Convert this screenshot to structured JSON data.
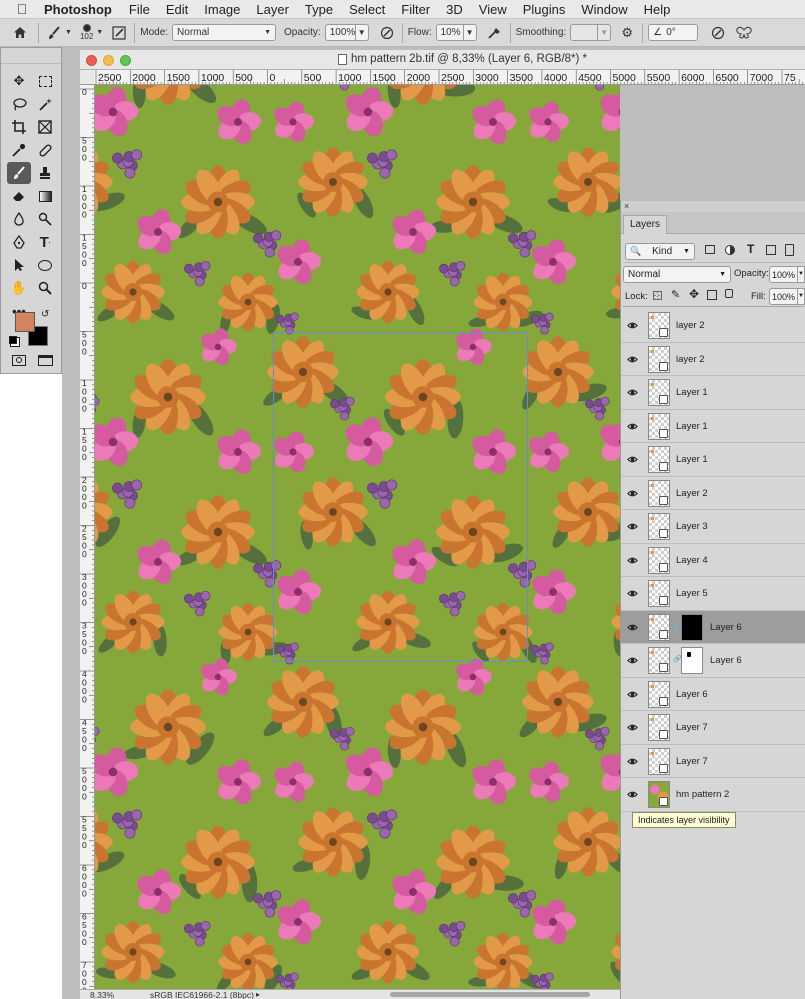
{
  "menubar": {
    "app_name": "Photoshop",
    "items": [
      "File",
      "Edit",
      "Image",
      "Layer",
      "Type",
      "Select",
      "Filter",
      "3D",
      "View",
      "Plugins",
      "Window",
      "Help"
    ]
  },
  "options_bar": {
    "brush_size": "102",
    "mode_label": "Mode:",
    "mode_value": "Normal",
    "opacity_label": "Opacity:",
    "opacity_value": "100%",
    "flow_label": "Flow:",
    "flow_value": "10%",
    "smoothing_label": "Smoothing:",
    "smoothing_value": "",
    "angle_value": "0°"
  },
  "tools": {
    "foreground_color": "#d4835f",
    "background_color": "#000000",
    "more_label": "•••"
  },
  "document": {
    "title": "hm pattern 2b.tif @ 8,33% (Layer 6, RGB/8*) *",
    "zoom": "8.33%",
    "color_profile": "sRGB IEC61966-2.1 (8bpc)",
    "h_ruler_labels": [
      "2500",
      "2000",
      "1500",
      "1000",
      "500",
      "0",
      "500",
      "1000",
      "1500",
      "2000",
      "2500",
      "3000",
      "3500",
      "4000",
      "4500",
      "5000",
      "5500",
      "6000",
      "6500",
      "7000",
      "75"
    ],
    "v_ruler_labels": [
      "0",
      "5 0 0",
      "1 0 0 0",
      "1 5 0 0",
      "0",
      "5 0 0",
      "1 0 0 0",
      "1 5 0 0",
      "2 0 0 0",
      "2 5 0 0",
      "3 0 0 0",
      "3 5 0 0",
      "4 0 0 0",
      "4 5 0 0",
      "5 0 0 0",
      "5 5 0 0",
      "6 0 0 0",
      "6 5 0 0",
      "7 0 0 0"
    ]
  },
  "layers_panel": {
    "close_label": "×",
    "tab_label": "Layers",
    "kind_label": "Kind",
    "blend_mode": "Normal",
    "opacity_label": "Opacity:",
    "opacity_value": "100%",
    "lock_label": "Lock:",
    "fill_label": "Fill:",
    "fill_value": "100%",
    "layers": [
      {
        "name": "layer 2",
        "selected": false,
        "mask": ""
      },
      {
        "name": "layer 2",
        "selected": false,
        "mask": ""
      },
      {
        "name": "Layer 1",
        "selected": false,
        "mask": ""
      },
      {
        "name": "Layer 1",
        "selected": false,
        "mask": ""
      },
      {
        "name": "Layer 1",
        "selected": false,
        "mask": ""
      },
      {
        "name": "Layer 2",
        "selected": false,
        "mask": ""
      },
      {
        "name": "Layer 3",
        "selected": false,
        "mask": ""
      },
      {
        "name": "Layer 4",
        "selected": false,
        "mask": ""
      },
      {
        "name": "Layer 5",
        "selected": false,
        "mask": ""
      },
      {
        "name": "Layer 6",
        "selected": true,
        "mask": "black"
      },
      {
        "name": "Layer 6",
        "selected": false,
        "mask": "white"
      },
      {
        "name": "Layer 6",
        "selected": false,
        "mask": ""
      },
      {
        "name": "Layer 7",
        "selected": false,
        "mask": ""
      },
      {
        "name": "Layer 7",
        "selected": false,
        "mask": ""
      },
      {
        "name": "hm pattern 2",
        "selected": false,
        "mask": ""
      }
    ],
    "tooltip": "Indicates layer visibility"
  },
  "pattern_colors": {
    "background": "#86a83a",
    "orange": "#e39a48",
    "orange_dark": "#c9752f",
    "pink": "#ec79b8",
    "pink_dark": "#d65aa0",
    "purple": "#7a4b91",
    "leaf": "#4f6a3e"
  }
}
